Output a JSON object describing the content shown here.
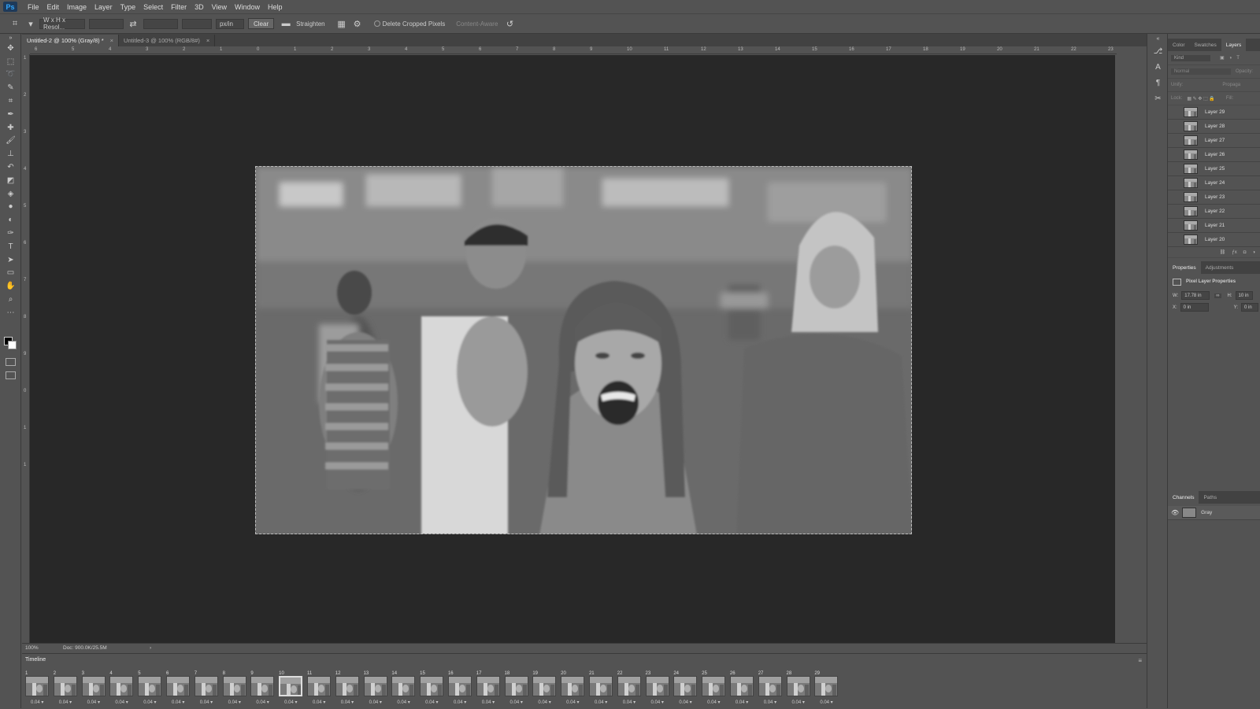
{
  "menu": {
    "logo": "Ps",
    "items": [
      "File",
      "Edit",
      "Image",
      "Layer",
      "Type",
      "Select",
      "Filter",
      "3D",
      "View",
      "Window",
      "Help"
    ]
  },
  "options": {
    "ratio": "W x H x Resol...",
    "unit": "px/in",
    "clear": "Clear",
    "straighten": "Straighten",
    "delete_cropped": "Delete Cropped Pixels",
    "content_aware": "Content-Aware"
  },
  "tabs": [
    {
      "label": "Untitled-2 @ 100% (Gray/8) *",
      "close": "×"
    },
    {
      "label": "Untitled-3 @ 100% (RGB/8#)",
      "close": "×"
    }
  ],
  "ruler_h": [
    "6",
    "5",
    "4",
    "3",
    "2",
    "1",
    "0",
    "1",
    "2",
    "3",
    "4",
    "5",
    "6",
    "7",
    "8",
    "9",
    "10",
    "11",
    "12",
    "13",
    "14",
    "15",
    "16",
    "17",
    "18",
    "19",
    "20",
    "21",
    "22",
    "23"
  ],
  "ruler_v": [
    "1",
    "2",
    "3",
    "4",
    "5",
    "6",
    "7",
    "8",
    "9",
    "0",
    "1",
    "1"
  ],
  "status": {
    "zoom": "100%",
    "doc": "Doc: 900.0K/25.5M",
    "arrow": "›"
  },
  "timeline": {
    "title": "Timeline",
    "frames": [
      {
        "n": "1",
        "d": "0.04"
      },
      {
        "n": "2",
        "d": "0.04"
      },
      {
        "n": "3",
        "d": "0.04"
      },
      {
        "n": "4",
        "d": "0.04"
      },
      {
        "n": "5",
        "d": "0.04"
      },
      {
        "n": "6",
        "d": "0.04"
      },
      {
        "n": "7",
        "d": "0.04"
      },
      {
        "n": "8",
        "d": "0.04"
      },
      {
        "n": "9",
        "d": "0.04"
      },
      {
        "n": "10",
        "d": "0.04"
      },
      {
        "n": "11",
        "d": "0.04"
      },
      {
        "n": "12",
        "d": "0.04"
      },
      {
        "n": "13",
        "d": "0.04"
      },
      {
        "n": "14",
        "d": "0.04"
      },
      {
        "n": "15",
        "d": "0.04"
      },
      {
        "n": "16",
        "d": "0.04"
      },
      {
        "n": "17",
        "d": "0.04"
      },
      {
        "n": "18",
        "d": "0.04"
      },
      {
        "n": "19",
        "d": "0.04"
      },
      {
        "n": "20",
        "d": "0.04"
      },
      {
        "n": "21",
        "d": "0.04"
      },
      {
        "n": "22",
        "d": "0.04"
      },
      {
        "n": "23",
        "d": "0.04"
      },
      {
        "n": "24",
        "d": "0.04"
      },
      {
        "n": "25",
        "d": "0.04"
      },
      {
        "n": "26",
        "d": "0.04"
      },
      {
        "n": "27",
        "d": "0.04"
      },
      {
        "n": "28",
        "d": "0.04"
      },
      {
        "n": "29",
        "d": "0.04"
      }
    ],
    "selected": "10"
  },
  "panels": {
    "top_tabs": [
      "Color",
      "Swatches",
      "Layers"
    ],
    "kind": "Kind",
    "blend": "Normal",
    "opacity": "Opacity:",
    "unify": "Unify:",
    "propagate": "Propaga",
    "lock": "Lock:",
    "fill": "Fill:",
    "layers": [
      "Layer 29",
      "Layer 28",
      "Layer 27",
      "Layer 26",
      "Layer 25",
      "Layer 24",
      "Layer 23",
      "Layer 22",
      "Layer 21",
      "Layer 20"
    ],
    "prop_tabs": [
      "Properties",
      "Adjustments"
    ],
    "prop_title": "Pixel Layer Properties",
    "w_label": "W:",
    "w_val": "17.78 in",
    "h_label": "H:",
    "h_val": "10 in",
    "x_label": "X:",
    "x_val": "0 in",
    "y_label": "Y:",
    "y_val": "0 in",
    "chan_tabs": [
      "Channels",
      "Paths"
    ],
    "channel": "Gray"
  }
}
